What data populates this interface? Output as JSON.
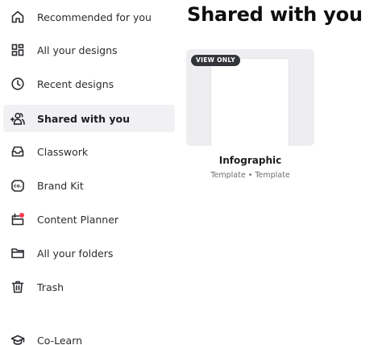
{
  "sidebar": {
    "items": [
      {
        "label": "Recommended for you",
        "icon": "home-icon",
        "active": false
      },
      {
        "label": "All your designs",
        "icon": "grid-icon",
        "active": false
      },
      {
        "label": "Recent designs",
        "icon": "clock-icon",
        "active": false
      },
      {
        "label": "Shared with you",
        "icon": "shared-users-icon",
        "active": true
      },
      {
        "label": "Classwork",
        "icon": "inbox-tray-icon",
        "active": false
      },
      {
        "label": "Brand Kit",
        "icon": "brand-kit-icon",
        "active": false
      },
      {
        "label": "Content Planner",
        "icon": "calendar-icon",
        "active": false
      },
      {
        "label": "All your folders",
        "icon": "folder-icon",
        "active": false
      },
      {
        "label": "Trash",
        "icon": "trash-icon",
        "active": false
      },
      {
        "label": "Co-Learn",
        "icon": "graduation-cap-icon",
        "active": false
      }
    ]
  },
  "main": {
    "title": "Shared with you",
    "cards": [
      {
        "badge": "VIEW ONLY",
        "title": "Infographic",
        "subtitle": "Template • Template"
      }
    ]
  },
  "colors": {
    "active_background": "#f1f1f3",
    "thumbnail_background": "#eeeef1",
    "badge_background": "#34353a",
    "notification_dot": "#ff3b4e"
  }
}
